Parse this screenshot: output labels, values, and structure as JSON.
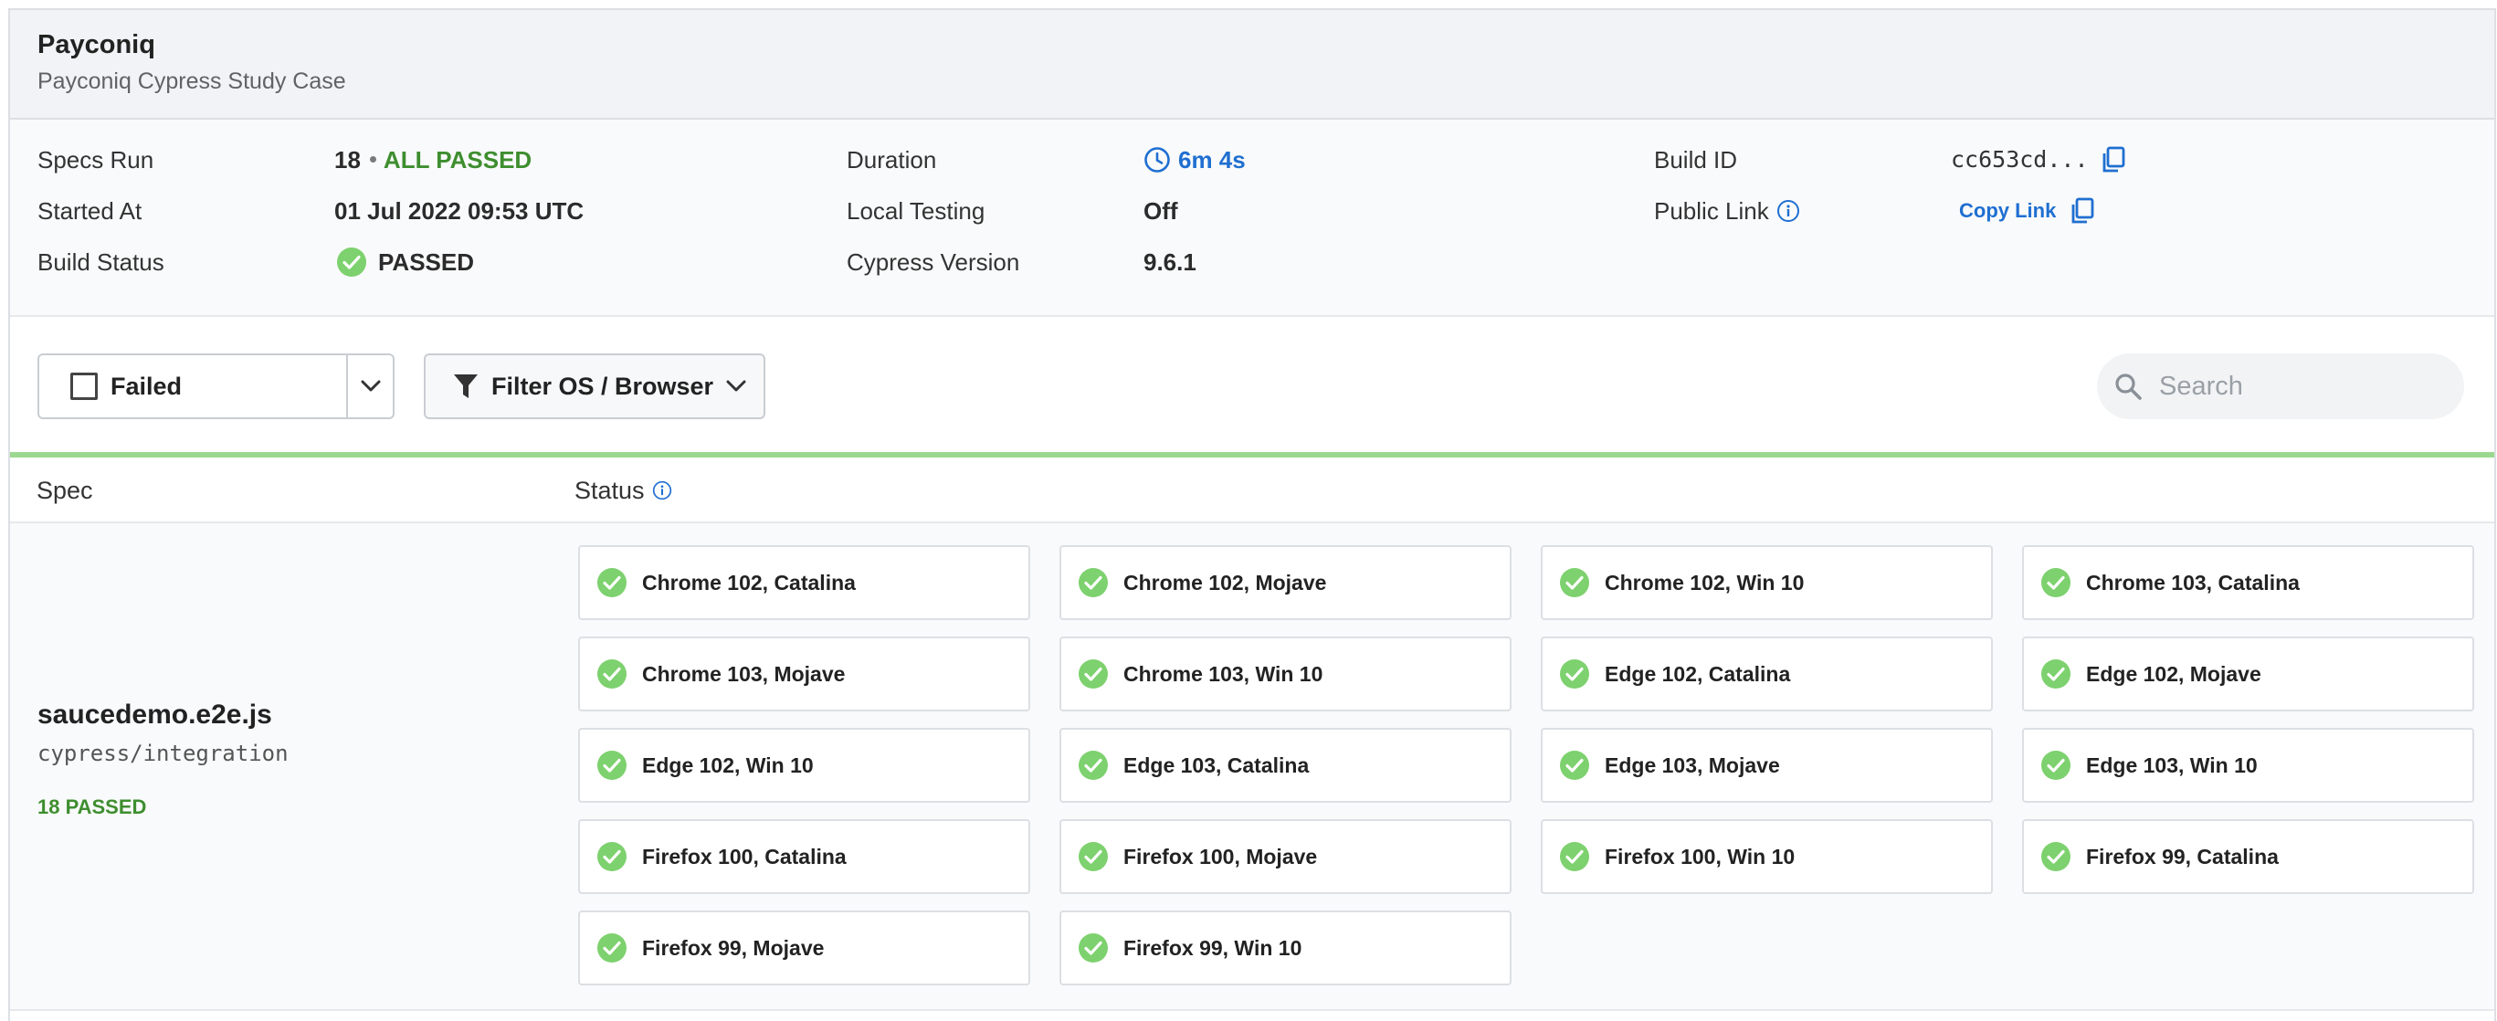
{
  "header": {
    "title": "Payconiq",
    "subtitle": "Payconiq Cypress Study Case"
  },
  "summary": {
    "specs_run_label": "Specs Run",
    "specs_run_count": "18",
    "specs_run_status": "ALL PASSED",
    "started_at_label": "Started At",
    "started_at_value": "01 Jul 2022 09:53 UTC",
    "build_status_label": "Build Status",
    "build_status_value": "PASSED",
    "duration_label": "Duration",
    "duration_value": "6m 4s",
    "local_testing_label": "Local Testing",
    "local_testing_value": "Off",
    "cypress_version_label": "Cypress Version",
    "cypress_version_value": "9.6.1",
    "build_id_label": "Build ID",
    "build_id_value": "cc653cd...",
    "public_link_label": "Public Link",
    "copy_link_label": "Copy Link"
  },
  "toolbar": {
    "failed_label": "Failed",
    "filter_label": "Filter OS / Browser",
    "search_placeholder": "Search"
  },
  "table": {
    "col_spec": "Spec",
    "col_status": "Status"
  },
  "spec": {
    "name": "saucedemo.e2e.js",
    "path": "cypress/integration",
    "count": "18 PASSED"
  },
  "runs": [
    "Chrome 102, Catalina",
    "Chrome 102, Mojave",
    "Chrome 102, Win 10",
    "Chrome 103, Catalina",
    "Chrome 103, Mojave",
    "Chrome 103, Win 10",
    "Edge 102, Catalina",
    "Edge 102, Mojave",
    "Edge 102, Win 10",
    "Edge 103, Catalina",
    "Edge 103, Mojave",
    "Edge 103, Win 10",
    "Firefox 100, Catalina",
    "Firefox 100, Mojave",
    "Firefox 100, Win 10",
    "Firefox 99, Catalina",
    "Firefox 99, Mojave",
    "Firefox 99, Win 10"
  ],
  "colors": {
    "pass_green": "#3e8e2f",
    "check_green": "#7dd16e",
    "link_blue": "#1f6fd1",
    "divider_green": "#9bd88f"
  }
}
